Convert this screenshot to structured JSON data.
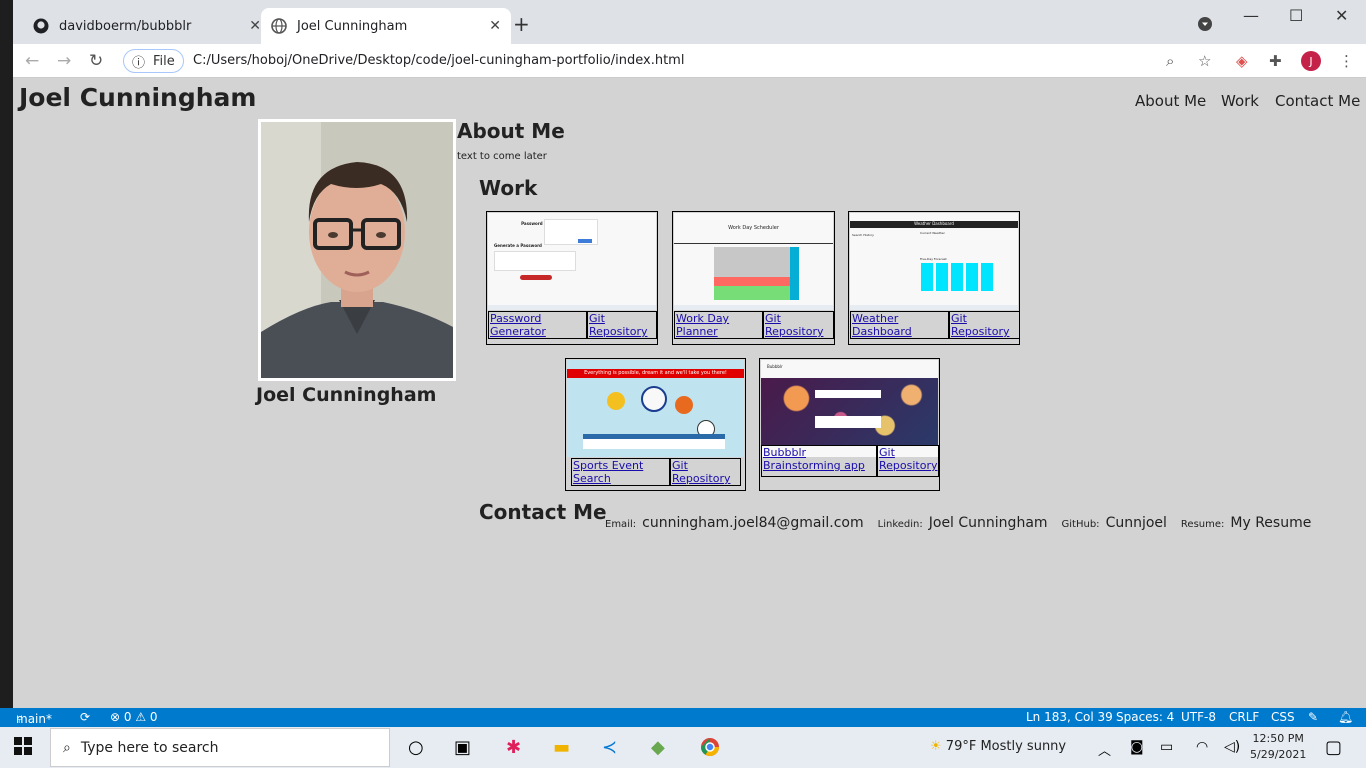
{
  "browser": {
    "tabs": [
      {
        "label": "davidboerm/bubbblr",
        "active": false
      },
      {
        "label": "Joel Cunningham",
        "active": true
      }
    ],
    "file_label": "File",
    "url": "C:/Users/hoboj/OneDrive/Desktop/code/joel-cuningham-portfolio/index.html",
    "avatar": "J"
  },
  "site": {
    "title": "Joel Cunningham",
    "nav": [
      "About Me",
      "Work",
      "Contact Me"
    ],
    "name": "Joel Cunningham",
    "about": {
      "heading": "About Me",
      "text": "text to come later"
    },
    "work": {
      "heading": "Work",
      "projects": [
        {
          "title": "Password Generator",
          "repo": "Git Repository",
          "shot": {
            "title": "Password Generator",
            "banner": "Generate a Password"
          }
        },
        {
          "title": "Work Day Planner",
          "repo": "Git Repository",
          "shot": {
            "title": "Work Day Scheduler"
          }
        },
        {
          "title": "Weather Dashboard",
          "repo": "Git Repository",
          "shot": {
            "title": "Weather Dashboard",
            "sub": "Search History",
            "h": "Current Weather",
            "f": "Five-Day Forecast"
          }
        },
        {
          "title": "Sports Event Search",
          "repo": "Git Repository",
          "shot": {
            "banner": "Everything is possible, dream it and we'll take you there!"
          }
        },
        {
          "title": "Bubbblr Brainstorming app",
          "repo": "Git Repository",
          "shot": {
            "title": "Bubbblr"
          }
        }
      ]
    },
    "contact": {
      "heading": "Contact Me",
      "items": [
        {
          "label": "Email:",
          "value": "cunningham.joel84@gmail.com"
        },
        {
          "label": "Linkedin:",
          "value": "Joel Cunningham"
        },
        {
          "label": "GitHub:",
          "value": "Cunnjoel"
        },
        {
          "label": "Resume:",
          "value": "My Resume"
        }
      ]
    }
  },
  "status": {
    "branch": "main*",
    "problems": "⊗ 0 ⚠ 0",
    "position": "Ln 183, Col 39",
    "spaces": "Spaces: 4",
    "encoding": "UTF-8",
    "eol": "CRLF",
    "language": "CSS"
  },
  "taskbar": {
    "search_placeholder": "Type here to search",
    "weather": "79°F  Mostly sunny",
    "time": "12:50 PM",
    "date": "5/29/2021"
  }
}
